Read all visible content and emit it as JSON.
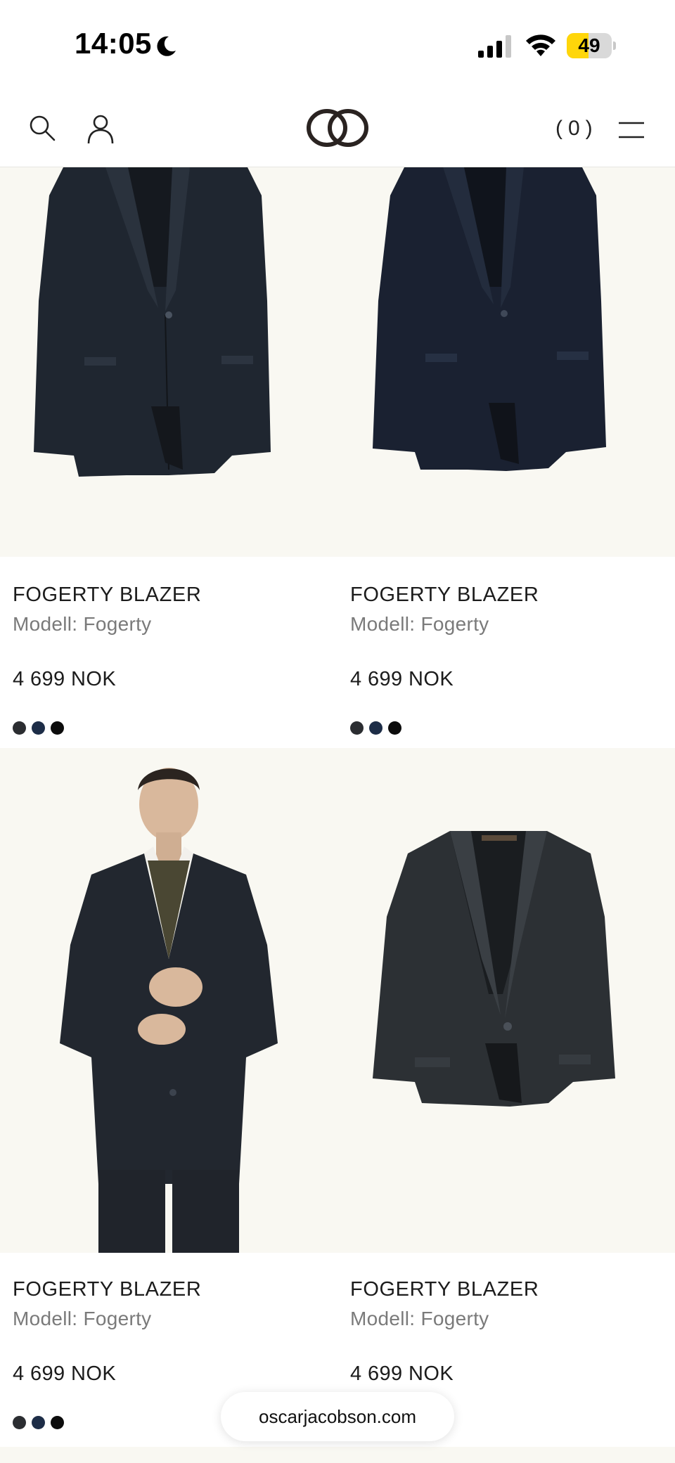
{
  "status_bar": {
    "time": "14:05",
    "battery_level": "49",
    "battery_fraction": 0.49,
    "icons": [
      "moon-icon",
      "signal-icon",
      "wifi-icon",
      "battery-icon"
    ]
  },
  "header": {
    "cart_count": "(0)",
    "icons": [
      "search-icon",
      "account-icon",
      "logo-icon",
      "menu-icon"
    ]
  },
  "products": [
    {
      "title": "FOGERTY BLAZER",
      "model": "Modell: Fogerty",
      "price": "4 699 NOK",
      "swatches": [
        "#2b2d31",
        "#1d2d47",
        "#0c0c0c"
      ],
      "image": "blazer-navy-check-front"
    },
    {
      "title": "FOGERTY BLAZER",
      "model": "Modell: Fogerty",
      "price": "4 699 NOK",
      "swatches": [
        "#2b2d31",
        "#1d2d47",
        "#0c0c0c"
      ],
      "image": "blazer-navy-front"
    },
    {
      "title": "FOGERTY BLAZER",
      "model": "Modell: Fogerty",
      "price": "4 699 NOK",
      "swatches": [
        "#2b2d31",
        "#1d2d47",
        "#0c0c0c"
      ],
      "image": "model-wearing-blazer"
    },
    {
      "title": "FOGERTY BLAZER",
      "model": "Modell: Fogerty",
      "price": "4 699 NOK",
      "swatches": [
        "#2b2d31",
        "#1d2d47",
        "#0c0c0c"
      ],
      "image": "blazer-charcoal-check-front"
    }
  ],
  "browser": {
    "url": "oscarjacobson.com"
  },
  "colors": {
    "image_background": "#f9f8f2",
    "text_primary": "#1c1c1c",
    "text_secondary": "#7a7a7a",
    "battery_fill": "#ffd60a"
  }
}
